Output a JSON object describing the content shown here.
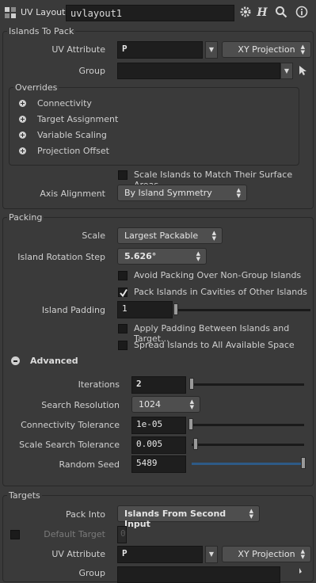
{
  "header": {
    "node_type": "UV Layout",
    "node_name": "uvlayout1",
    "icons": [
      "gear-icon",
      "help-h-icon",
      "magnify-icon",
      "info-icon"
    ]
  },
  "islands_to_pack": {
    "title": "Islands To Pack",
    "uv_attribute_label": "UV Attribute",
    "uv_attribute_value": "P",
    "projection_value": "XY Projection",
    "group_label": "Group",
    "group_value": "",
    "overrides": {
      "title": "Overrides",
      "items": [
        "Connectivity",
        "Target Assignment",
        "Variable Scaling",
        "Projection Offset"
      ]
    },
    "scale_islands_label": "Scale Islands to Match Their Surface Areas",
    "scale_islands_checked": false,
    "axis_alignment_label": "Axis Alignment",
    "axis_alignment_value": "By Island Symmetry"
  },
  "packing": {
    "title": "Packing",
    "scale_label": "Scale",
    "scale_value": "Largest Packable",
    "rotation_step_label": "Island Rotation Step",
    "rotation_step_value": "5.626°",
    "avoid_packing_label": "Avoid Packing Over Non-Group Islands",
    "avoid_packing_checked": false,
    "pack_cavities_label": "Pack Islands in Cavities of Other Islands",
    "pack_cavities_checked": true,
    "padding_label": "Island Padding",
    "padding_value": "1",
    "padding_fraction": 0.0,
    "apply_padding_label": "Apply Padding Between Islands and Target...",
    "apply_padding_checked": false,
    "spread_label": "Spread Islands to All Available Space",
    "spread_checked": false,
    "advanced": {
      "title": "Advanced",
      "iterations_label": "Iterations",
      "iterations_value": "2",
      "iterations_fraction": 0.01,
      "search_resolution_label": "Search Resolution",
      "search_resolution_value": "1024",
      "conn_tol_label": "Connectivity Tolerance",
      "conn_tol_value": "1e-05",
      "conn_tol_fraction": 0.0,
      "scale_tol_label": "Scale Search Tolerance",
      "scale_tol_value": "0.005",
      "scale_tol_fraction": 0.04,
      "seed_label": "Random Seed",
      "seed_value": "5489",
      "seed_fraction": 1.0
    }
  },
  "targets": {
    "title": "Targets",
    "pack_into_label": "Pack Into",
    "pack_into_value": "Islands From Second Input",
    "default_target_label": "Default Target",
    "default_target_value": "0",
    "uv_attribute_label": "UV Attribute",
    "uv_attribute_value": "P",
    "projection_value": "XY Projection",
    "group_label": "Group"
  },
  "colors": {
    "background": "#3a3a3a",
    "field": "#1e1e1e",
    "seed_slider_fill": "#2e5a86"
  }
}
